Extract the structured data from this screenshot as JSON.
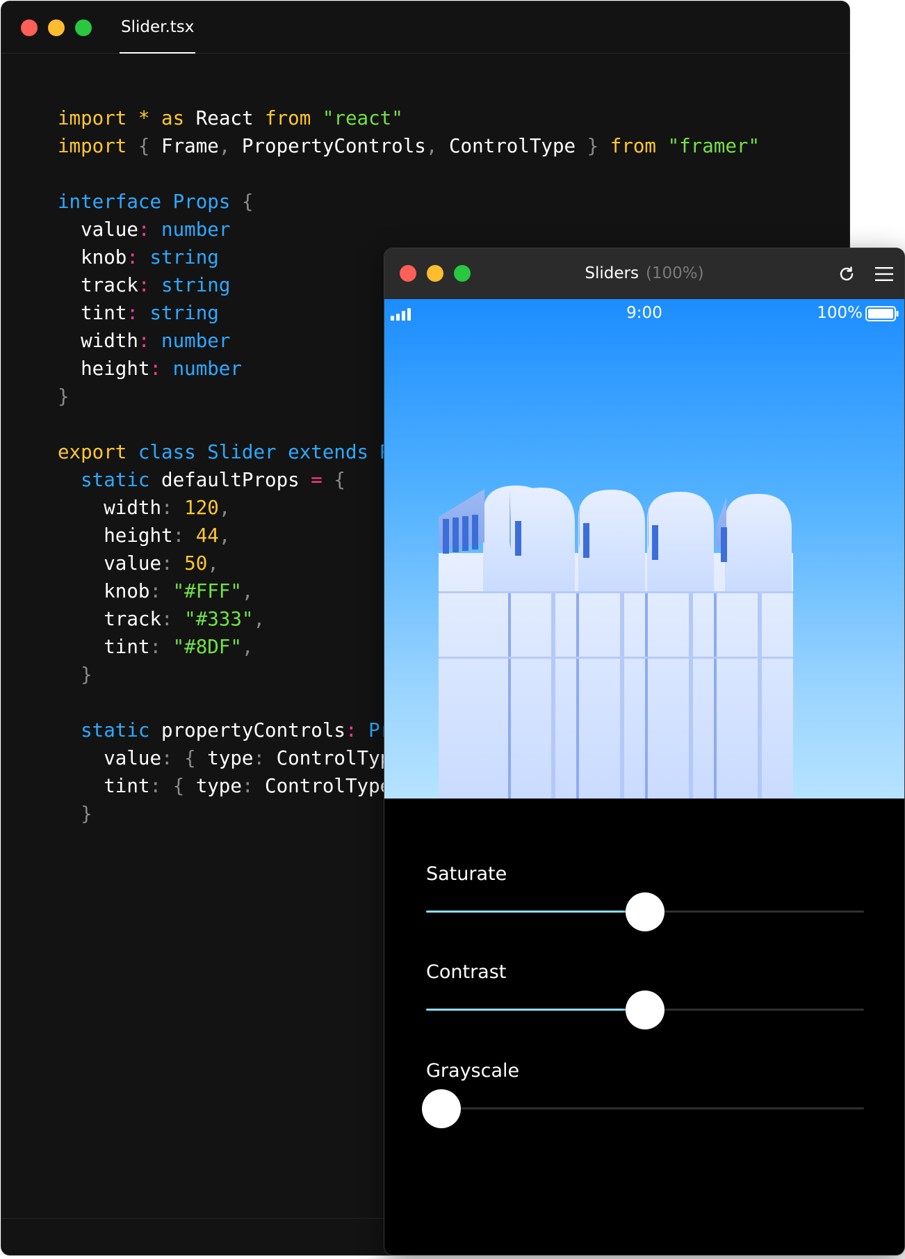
{
  "editor": {
    "tab_label": "Slider.tsx",
    "traffic_lights": [
      "#fe5f57",
      "#febc2e",
      "#28c840"
    ],
    "code_lines": [
      [
        [
          "import",
          "kw"
        ],
        [
          " ",
          "def"
        ],
        [
          "*",
          "kw"
        ],
        [
          " ",
          "def"
        ],
        [
          "as",
          "kw"
        ],
        [
          " React ",
          "def"
        ],
        [
          "from",
          "kw"
        ],
        [
          " ",
          "def"
        ],
        [
          "\"react\"",
          "str"
        ]
      ],
      [
        [
          "import",
          "kw"
        ],
        [
          " ",
          "def"
        ],
        [
          "{",
          "pun"
        ],
        [
          " Frame",
          "def"
        ],
        [
          ",",
          "pun"
        ],
        [
          " PropertyControls",
          "def"
        ],
        [
          ",",
          "pun"
        ],
        [
          " ControlType ",
          "def"
        ],
        [
          "}",
          "pun"
        ],
        [
          " ",
          "def"
        ],
        [
          "from",
          "kw"
        ],
        [
          " ",
          "def"
        ],
        [
          "\"framer\"",
          "str"
        ]
      ],
      [],
      [
        [
          "interface",
          "kw2"
        ],
        [
          " ",
          "def"
        ],
        [
          "Props",
          "kw2"
        ],
        [
          " ",
          "def"
        ],
        [
          "{",
          "pun"
        ]
      ],
      [
        [
          "  value",
          "def"
        ],
        [
          ":",
          "op"
        ],
        [
          " ",
          "def"
        ],
        [
          "number",
          "kw2"
        ]
      ],
      [
        [
          "  knob",
          "def"
        ],
        [
          ":",
          "op"
        ],
        [
          " ",
          "def"
        ],
        [
          "string",
          "kw2"
        ]
      ],
      [
        [
          "  track",
          "def"
        ],
        [
          ":",
          "op"
        ],
        [
          " ",
          "def"
        ],
        [
          "string",
          "kw2"
        ]
      ],
      [
        [
          "  tint",
          "def"
        ],
        [
          ":",
          "op"
        ],
        [
          " ",
          "def"
        ],
        [
          "string",
          "kw2"
        ]
      ],
      [
        [
          "  width",
          "def"
        ],
        [
          ":",
          "op"
        ],
        [
          " ",
          "def"
        ],
        [
          "number",
          "kw2"
        ]
      ],
      [
        [
          "  height",
          "def"
        ],
        [
          ":",
          "op"
        ],
        [
          " ",
          "def"
        ],
        [
          "number",
          "kw2"
        ]
      ],
      [
        [
          "}",
          "pun"
        ]
      ],
      [],
      [
        [
          "export",
          "kw"
        ],
        [
          " ",
          "def"
        ],
        [
          "class",
          "kw2"
        ],
        [
          " ",
          "def"
        ],
        [
          "Slider",
          "kw2"
        ],
        [
          " ",
          "def"
        ],
        [
          "extends",
          "kw2"
        ],
        [
          " ",
          "def"
        ],
        [
          "R",
          "kw2"
        ]
      ],
      [
        [
          "  ",
          "def"
        ],
        [
          "static",
          "kw2"
        ],
        [
          " defaultProps ",
          "def"
        ],
        [
          "=",
          "op"
        ],
        [
          " ",
          "def"
        ],
        [
          "{",
          "pun"
        ]
      ],
      [
        [
          "    width",
          "def"
        ],
        [
          ":",
          "pun"
        ],
        [
          " ",
          "def"
        ],
        [
          "120",
          "num"
        ],
        [
          ",",
          "pun"
        ]
      ],
      [
        [
          "    height",
          "def"
        ],
        [
          ":",
          "pun"
        ],
        [
          " ",
          "def"
        ],
        [
          "44",
          "num"
        ],
        [
          ",",
          "pun"
        ]
      ],
      [
        [
          "    value",
          "def"
        ],
        [
          ":",
          "pun"
        ],
        [
          " ",
          "def"
        ],
        [
          "50",
          "num"
        ],
        [
          ",",
          "pun"
        ]
      ],
      [
        [
          "    knob",
          "def"
        ],
        [
          ":",
          "pun"
        ],
        [
          " ",
          "def"
        ],
        [
          "\"#FFF\"",
          "str"
        ],
        [
          ",",
          "pun"
        ]
      ],
      [
        [
          "    track",
          "def"
        ],
        [
          ":",
          "pun"
        ],
        [
          " ",
          "def"
        ],
        [
          "\"#333\"",
          "str"
        ],
        [
          ",",
          "pun"
        ]
      ],
      [
        [
          "    tint",
          "def"
        ],
        [
          ":",
          "pun"
        ],
        [
          " ",
          "def"
        ],
        [
          "\"#8DF\"",
          "str"
        ],
        [
          ",",
          "pun"
        ]
      ],
      [
        [
          "  ",
          "def"
        ],
        [
          "}",
          "pun"
        ]
      ],
      [],
      [
        [
          "  ",
          "def"
        ],
        [
          "static",
          "kw2"
        ],
        [
          " propertyControls",
          "def"
        ],
        [
          ":",
          "op"
        ],
        [
          " ",
          "def"
        ],
        [
          "Pr",
          "kw2"
        ]
      ],
      [
        [
          "    value",
          "def"
        ],
        [
          ":",
          "pun"
        ],
        [
          " ",
          "def"
        ],
        [
          "{",
          "pun"
        ],
        [
          " type",
          "def"
        ],
        [
          ":",
          "pun"
        ],
        [
          " ControlTyp",
          "def"
        ]
      ],
      [
        [
          "    tint",
          "def"
        ],
        [
          ":",
          "pun"
        ],
        [
          " ",
          "def"
        ],
        [
          "{",
          "pun"
        ],
        [
          " type",
          "def"
        ],
        [
          ":",
          "pun"
        ],
        [
          " ControlType",
          "def"
        ]
      ],
      [
        [
          "  ",
          "def"
        ],
        [
          "}",
          "pun"
        ]
      ]
    ]
  },
  "preview": {
    "title": "Sliders",
    "zoom": "(100%)",
    "traffic_lights": [
      "#fe5f57",
      "#febc2e",
      "#28c840"
    ],
    "status_bar": {
      "time": "9:00",
      "battery": "100%"
    },
    "sliders": [
      {
        "label": "Saturate",
        "value": 0.5
      },
      {
        "label": "Contrast",
        "value": 0.5
      },
      {
        "label": "Grayscale",
        "value": 0.0
      }
    ],
    "colors": {
      "track": "#2f2f2f",
      "tint": "#8ddcff",
      "knob": "#ffffff"
    }
  }
}
